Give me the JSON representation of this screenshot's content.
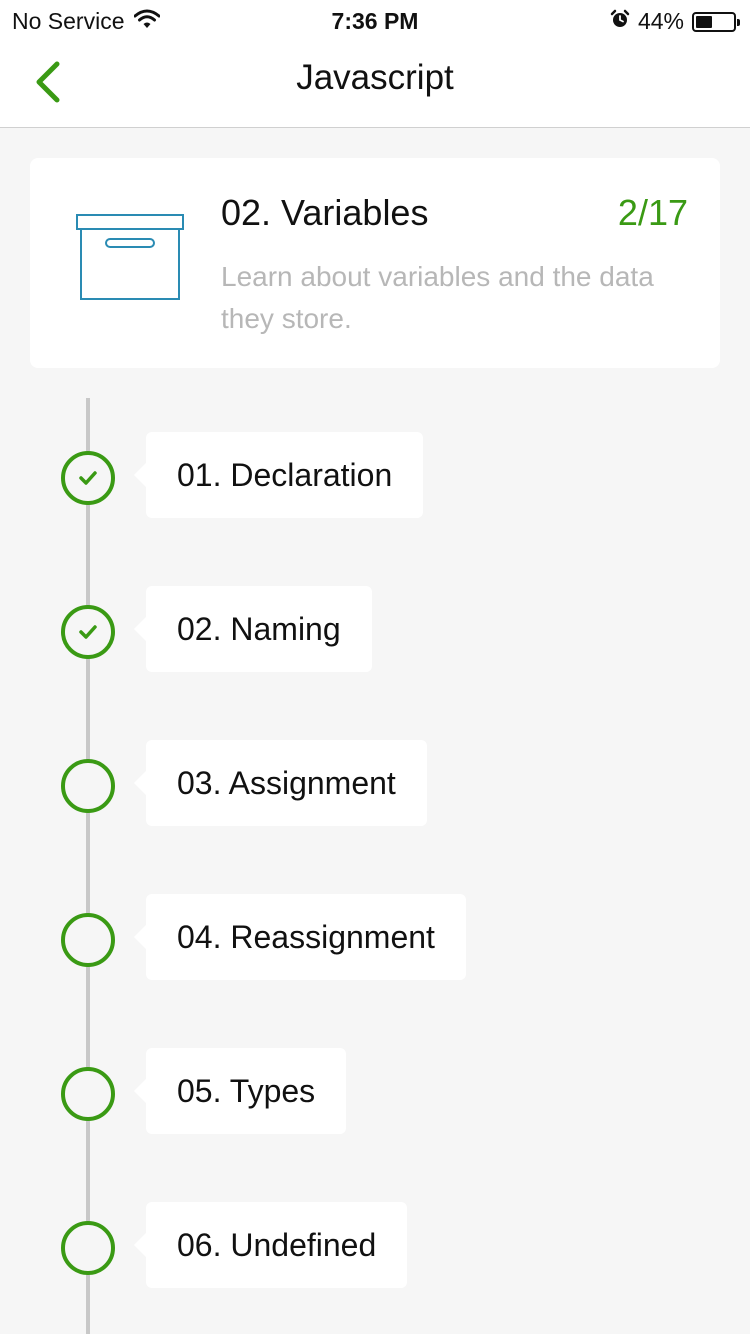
{
  "status_bar": {
    "carrier": "No Service",
    "time": "7:36 PM",
    "battery_percent": "44%",
    "battery_level": 0.44,
    "icons": [
      "wifi-icon",
      "alarm-icon",
      "battery-icon"
    ]
  },
  "nav": {
    "title": "Javascript",
    "back_icon": "chevron-left-icon"
  },
  "lesson": {
    "title": "02. Variables",
    "progress": "2/17",
    "description": "Learn about variables and the data they store.",
    "icon": "storage-box-icon"
  },
  "steps": [
    {
      "label": "01. Declaration",
      "completed": true
    },
    {
      "label": "02. Naming",
      "completed": true
    },
    {
      "label": "03. Assignment",
      "completed": false
    },
    {
      "label": "04. Reassignment",
      "completed": false
    },
    {
      "label": "05. Types",
      "completed": false
    },
    {
      "label": "06. Undefined",
      "completed": false
    }
  ],
  "colors": {
    "accent": "#3a9a14",
    "box_icon": "#2a8bb3",
    "muted_text": "#b7b7b7",
    "background": "#f6f6f6"
  }
}
